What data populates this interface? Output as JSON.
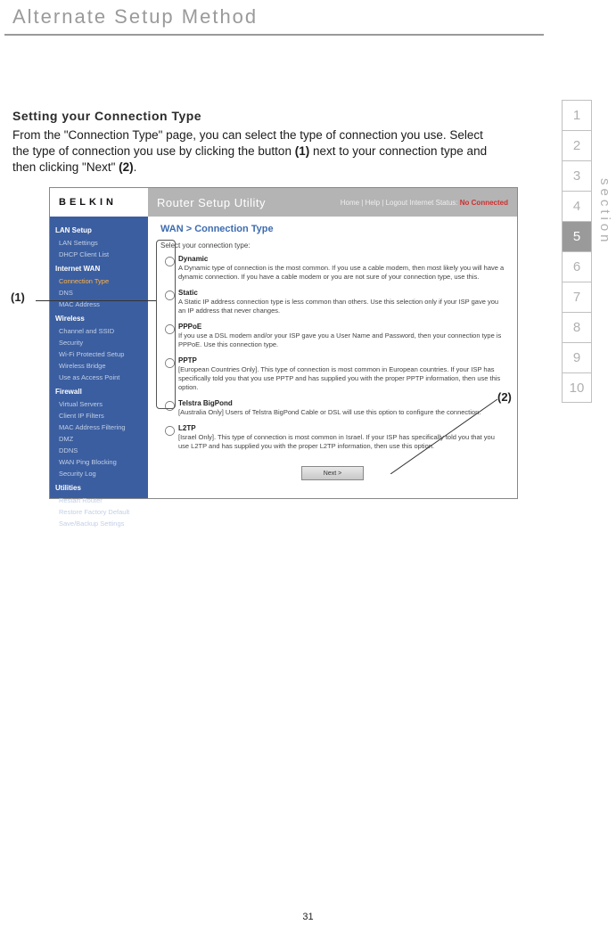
{
  "page": {
    "title": "Alternate Setup Method",
    "subtitle": "Setting your Connection Type",
    "body_html": "From the \"Connection Type\" page, you can select the type of connection you use. Select the type of connection you use by clicking the button ",
    "body_bold1": "(1)",
    "body_mid": " next to your connection type and then clicking \"Next\" ",
    "body_bold2": "(2)",
    "body_end": ".",
    "callout1": "(1)",
    "callout2": "(2)",
    "page_number": "31",
    "section_label": "section"
  },
  "sections": [
    "1",
    "2",
    "3",
    "4",
    "5",
    "6",
    "7",
    "8",
    "9",
    "10"
  ],
  "active_section_index": 4,
  "router_ui": {
    "logo": "BELKIN",
    "topbar_title": "Router Setup Utility",
    "top_links_text": "Home | Help | Logout   Internet Status:",
    "top_links_status": "No Connected",
    "main_heading": "WAN > Connection Type",
    "select_text": "Select your connection type:",
    "next_button": "Next >",
    "sidebar": {
      "groups": [
        {
          "header": "LAN Setup",
          "items": [
            "LAN Settings",
            "DHCP Client List"
          ]
        },
        {
          "header": "Internet WAN",
          "items_active": [
            "Connection Type"
          ],
          "items": [
            "DNS",
            "MAC Address"
          ]
        },
        {
          "header": "Wireless",
          "items": [
            "Channel and SSID",
            "Security",
            "Wi-Fi Protected Setup",
            "Wireless Bridge",
            "Use as Access Point"
          ]
        },
        {
          "header": "Firewall",
          "items": [
            "Virtual Servers",
            "Client IP Filters",
            "MAC Address Filtering",
            "DMZ",
            "DDNS",
            "WAN Ping Blocking",
            "Security Log"
          ]
        },
        {
          "header": "Utilities",
          "items": [
            "Restart Router",
            "Restore Factory Default",
            "Save/Backup Settings"
          ]
        }
      ]
    },
    "options": [
      {
        "name": "Dynamic",
        "desc": "A Dynamic type of connection is the most common. If you use a cable modem, then most likely you will have a dynamic connection. If you have a cable modem or you are not sure of your connection type, use this."
      },
      {
        "name": "Static",
        "desc": "A Static IP address connection type is less common than others. Use this selection only if your ISP gave you an IP address that never changes."
      },
      {
        "name": "PPPoE",
        "desc": "If you use a DSL modem and/or your ISP gave you a User Name and Password, then your connection type is PPPoE. Use this connection type."
      },
      {
        "name": "PPTP",
        "desc": "[European Countries Only]. This type of connection is most common in European countries. If your ISP has specifically told you that you use PPTP and has supplied you with the proper PPTP information, then use this option."
      },
      {
        "name": "Telstra BigPond",
        "desc": "[Australia Only] Users of Telstra BigPond Cable or DSL will use this option to configure the connection."
      },
      {
        "name": "L2TP",
        "desc": "[Israel Only]. This type of connection is most common in Israel. If your ISP has specifically told you that you use L2TP and has supplied you with the proper L2TP information, then use this option."
      }
    ]
  }
}
